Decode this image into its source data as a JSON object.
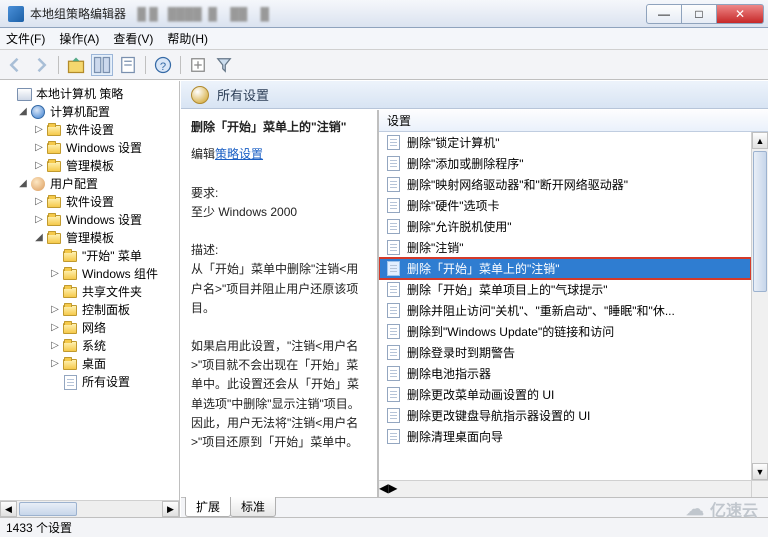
{
  "window": {
    "title": "本地组策略编辑器",
    "btn_min": "—",
    "btn_max": "□",
    "btn_close": "✕"
  },
  "menu": {
    "file": "文件(F)",
    "action": "操作(A)",
    "view": "查看(V)",
    "help": "帮助(H)"
  },
  "tree": {
    "root": "本地计算机 策略",
    "computer": "计算机配置",
    "c_software": "软件设置",
    "c_windows": "Windows 设置",
    "c_admin": "管理模板",
    "user": "用户配置",
    "u_software": "软件设置",
    "u_windows": "Windows 设置",
    "u_admin": "管理模板",
    "start_menu": "\"开始\" 菜单",
    "windows_comp": "Windows 组件",
    "shared": "共享文件夹",
    "control_panel": "控制面板",
    "network": "网络",
    "system": "系统",
    "desktop": "桌面",
    "all_settings": "所有设置"
  },
  "right": {
    "header": "所有设置",
    "desc": {
      "policy_title": "删除「开始」菜单上的\"注销\"",
      "edit_prefix": "编辑",
      "edit_link": "策略设置",
      "req_label": "要求:",
      "req_value": "至少 Windows 2000",
      "desc_label": "描述:",
      "desc_p1": "从「开始」菜单中删除\"注销<用户名>\"项目并阻止用户还原该项目。",
      "desc_p2": "如果启用此设置，\"注销<用户名>\"项目就不会出现在「开始」菜单中。此设置还会从「开始」菜单选项\"中删除\"显示注销\"项目。因此，用户无法将\"注销<用户名>\"项目还原到「开始」菜单中。"
    },
    "list": {
      "header_col": "设置",
      "items": [
        "删除\"锁定计算机\"",
        "删除\"添加或删除程序\"",
        "删除\"映射网络驱动器\"和\"断开网络驱动器\"",
        "删除\"硬件\"选项卡",
        "删除\"允许脱机使用\"",
        "删除\"注销\"",
        "删除「开始」菜单上的\"注销\"",
        "删除「开始」菜单项目上的\"气球提示\"",
        "删除并阻止访问\"关机\"、\"重新启动\"、\"睡眠\"和\"休...",
        "删除到\"Windows Update\"的链接和访问",
        "删除登录时到期警告",
        "删除电池指示器",
        "删除更改菜单动画设置的 UI",
        "删除更改键盘导航指示器设置的 UI",
        "删除清理桌面向导"
      ],
      "selected_index": 6
    },
    "tabs": {
      "extended": "扩展",
      "standard": "标准"
    }
  },
  "statusbar": {
    "text": "1433 个设置"
  },
  "watermark": {
    "text": "亿速云"
  }
}
